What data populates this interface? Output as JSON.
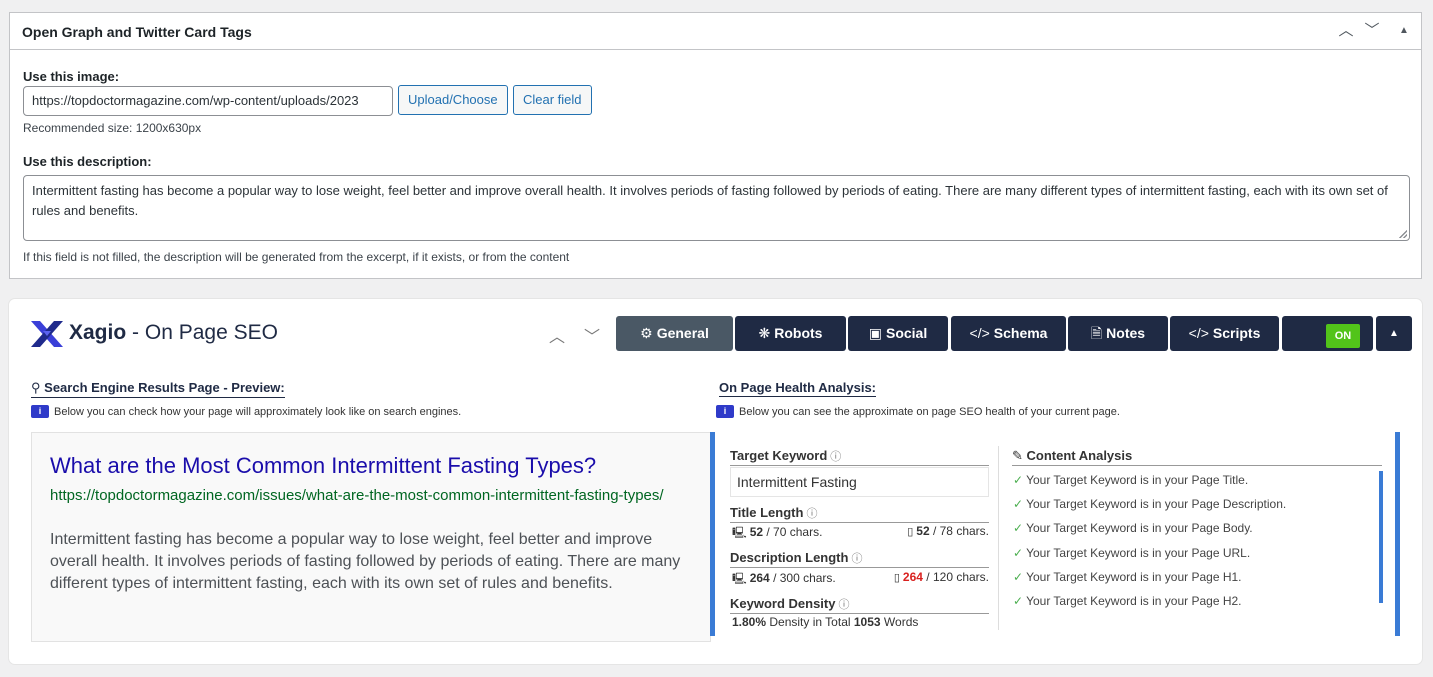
{
  "og": {
    "title": "Open Graph and Twitter Card Tags",
    "image_label": "Use this image:",
    "image_value": "https://topdoctormagazine.com/wp-content/uploads/2023",
    "upload_btn": "Upload/Choose",
    "clear_btn": "Clear field",
    "recommended": "Recommended size: 1200x630px",
    "desc_label": "Use this description:",
    "desc_value": "Intermittent fasting has become a popular way to lose weight, feel better and improve overall health. It involves periods of fasting followed by periods of eating. There are many different types of intermittent fasting, each with its own set of rules and benefits.",
    "desc_hint": "If this field is not filled, the description will be generated from the excerpt, if it exists, or from the content"
  },
  "xagio": {
    "brand_name": "Xagio",
    "brand_suffix": "- On Page SEO",
    "tabs": {
      "general": "General",
      "robots": "Robots",
      "social": "Social",
      "schema": "Schema",
      "notes": "Notes",
      "scripts": "Scripts"
    },
    "on_label": "ON",
    "serp_heading": "Search Engine Results Page - Preview:",
    "serp_note": "Below you can check how your page will approximately look like on search engines.",
    "health_heading": "On Page Health Analysis:",
    "health_note": "Below you can see the approximate on page SEO health of your current page.",
    "serp": {
      "title": "What are the Most Common Intermittent Fasting Types?",
      "url": "https://topdoctormagazine.com/issues/what-are-the-most-common-intermittent-fasting-types/",
      "desc": "Intermittent fasting has become a popular way to lose weight, feel better and improve overall health. It involves periods of fasting followed by periods of eating. There are many different types of intermittent fasting, each with its own set of rules and benefits."
    },
    "health": {
      "target_keyword_label": "Target Keyword",
      "target_keyword": "Intermittent Fasting",
      "title_length_label": "Title Length",
      "title_desktop_count": "52",
      "title_desktop_max": "/ 70 chars.",
      "title_mobile_count": "52",
      "title_mobile_max": "/ 78 chars.",
      "desc_length_label": "Description Length",
      "desc_desktop_count": "264",
      "desc_desktop_max": "/ 300 chars.",
      "desc_mobile_count": "264",
      "desc_mobile_max": "/ 120 chars.",
      "density_label": "Keyword Density",
      "density_pct": "1.80%",
      "density_text": "Density in Total",
      "density_words": "1053",
      "density_words_label": "Words",
      "content_analysis_title": "Content Analysis",
      "checks": [
        "Your Target Keyword is in your Page Title.",
        "Your Target Keyword is in your Page Description.",
        "Your Target Keyword is in your Page Body.",
        "Your Target Keyword is in your Page URL.",
        "Your Target Keyword is in your Page H1.",
        "Your Target Keyword is in your Page H2."
      ]
    }
  }
}
